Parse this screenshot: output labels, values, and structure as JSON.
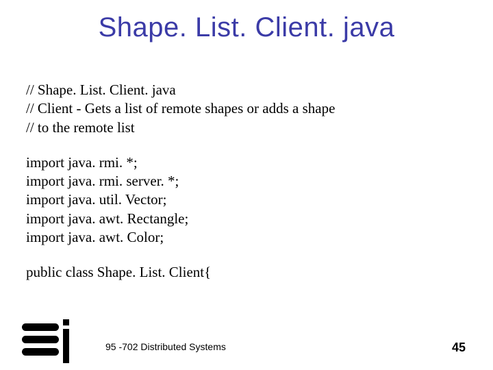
{
  "title": "Shape. List. Client. java",
  "comments": {
    "line1": "// Shape. List. Client. java",
    "line2": "// Client - Gets a list of remote shapes or adds a shape",
    "line3": "// to the remote list"
  },
  "imports": {
    "line1": "import java. rmi. *;",
    "line2": "import java. rmi. server. *;",
    "line3": "import java. util. Vector;",
    "line4": "import java. awt. Rectangle;",
    "line5": "import java. awt. Color;"
  },
  "classDecl": "public class Shape. List. Client{",
  "footer": {
    "course": "95 -702 Distributed Systems",
    "page": "45"
  }
}
